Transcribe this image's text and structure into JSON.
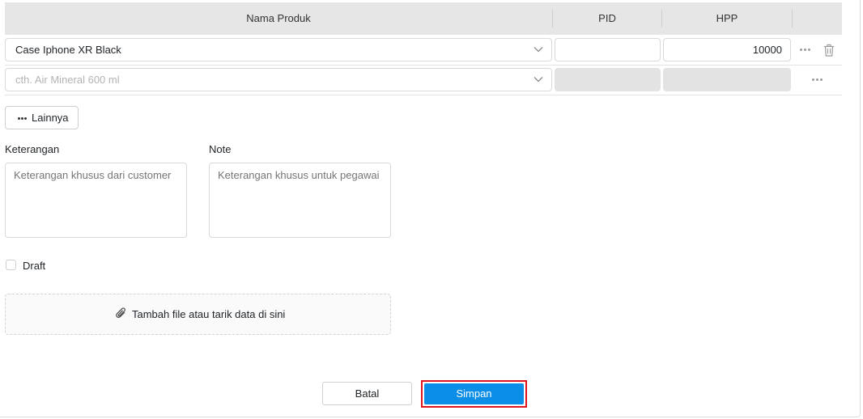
{
  "table": {
    "headers": {
      "name": "Nama Produk",
      "pid": "PID",
      "hpp": "HPP"
    },
    "rows": [
      {
        "product": "Case Iphone XR Black",
        "pid": "",
        "hpp": "10000"
      },
      {
        "product_placeholder": "cth. Air Mineral 600 ml",
        "pid": "",
        "hpp": ""
      }
    ]
  },
  "more_button": {
    "label": "Lainnya"
  },
  "keterangan": {
    "label": "Keterangan",
    "placeholder": "Keterangan khusus dari customer"
  },
  "note": {
    "label": "Note",
    "placeholder": "Keterangan khusus untuk pegawai"
  },
  "draft": {
    "label": "Draft",
    "checked": false
  },
  "upload": {
    "label": "Tambah file atau tarik data di sini",
    "icon": "paperclip-icon"
  },
  "actions": {
    "cancel_label": "Batal",
    "save_label": "Simpan"
  },
  "colors": {
    "primary": "#0b8ee8",
    "highlight_border": "#e0141e",
    "header_bg": "#e6e6e6",
    "disabled_bg": "#e3e3e3"
  }
}
